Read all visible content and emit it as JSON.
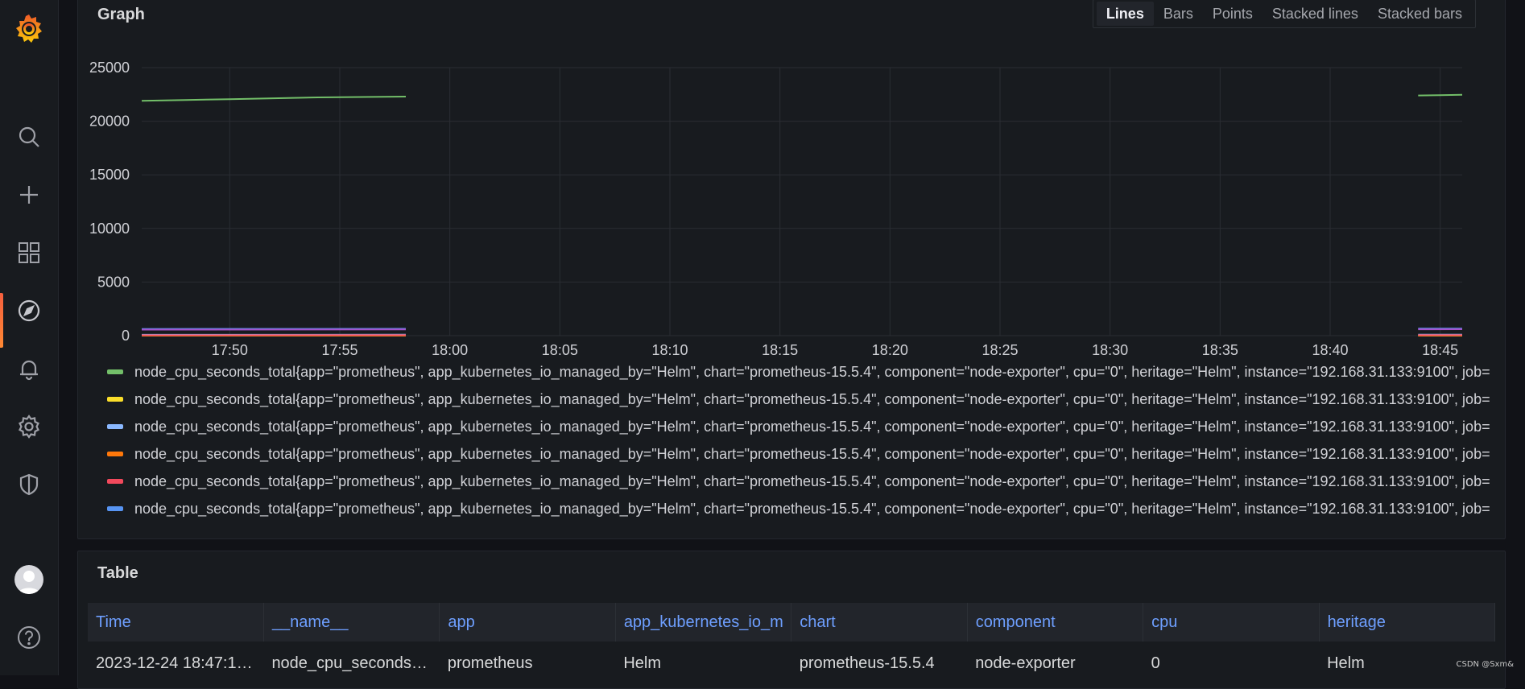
{
  "sidebar": {
    "logo": "grafana-logo",
    "items": [
      {
        "name": "search-icon"
      },
      {
        "name": "plus-icon"
      },
      {
        "name": "dashboards-icon"
      },
      {
        "name": "explore-icon",
        "active": true
      },
      {
        "name": "bell-icon"
      },
      {
        "name": "gear-icon"
      },
      {
        "name": "shield-icon"
      }
    ],
    "bottom": [
      {
        "name": "avatar"
      },
      {
        "name": "help-icon"
      }
    ]
  },
  "graph_panel": {
    "title": "Graph",
    "modes": [
      "Lines",
      "Bars",
      "Points",
      "Stacked lines",
      "Stacked bars"
    ],
    "active_mode": "Lines",
    "legend": [
      {
        "label": "node_cpu_seconds_total{app=\"prometheus\", app_kubernetes_io_managed_by=\"Helm\", chart=\"prometheus-15.5.4\", component=\"node-exporter\", cpu=\"0\", heritage=\"Helm\", instance=\"192.168.31.133:9100\", job=",
        "color": "#73bf69"
      },
      {
        "label": "node_cpu_seconds_total{app=\"prometheus\", app_kubernetes_io_managed_by=\"Helm\", chart=\"prometheus-15.5.4\", component=\"node-exporter\", cpu=\"0\", heritage=\"Helm\", instance=\"192.168.31.133:9100\", job=",
        "color": "#fade2a"
      },
      {
        "label": "node_cpu_seconds_total{app=\"prometheus\", app_kubernetes_io_managed_by=\"Helm\", chart=\"prometheus-15.5.4\", component=\"node-exporter\", cpu=\"0\", heritage=\"Helm\", instance=\"192.168.31.133:9100\", job=",
        "color": "#8ab8ff"
      },
      {
        "label": "node_cpu_seconds_total{app=\"prometheus\", app_kubernetes_io_managed_by=\"Helm\", chart=\"prometheus-15.5.4\", component=\"node-exporter\", cpu=\"0\", heritage=\"Helm\", instance=\"192.168.31.133:9100\", job=",
        "color": "#ff780a"
      },
      {
        "label": "node_cpu_seconds_total{app=\"prometheus\", app_kubernetes_io_managed_by=\"Helm\", chart=\"prometheus-15.5.4\", component=\"node-exporter\", cpu=\"0\", heritage=\"Helm\", instance=\"192.168.31.133:9100\", job=",
        "color": "#f2495c"
      },
      {
        "label": "node_cpu_seconds_total{app=\"prometheus\", app_kubernetes_io_managed_by=\"Helm\", chart=\"prometheus-15.5.4\", component=\"node-exporter\", cpu=\"0\", heritage=\"Helm\", instance=\"192.168.31.133:9100\", job=",
        "color": "#5794f2"
      }
    ]
  },
  "chart_data": {
    "type": "line",
    "title": "Graph",
    "xlabel": "",
    "ylabel": "",
    "x_ticks": [
      "17:50",
      "17:55",
      "18:00",
      "18:05",
      "18:10",
      "18:15",
      "18:20",
      "18:25",
      "18:30",
      "18:35",
      "18:40",
      "18:45"
    ],
    "xlim": [
      "17:46",
      "18:46"
    ],
    "y_ticks": [
      0,
      5000,
      10000,
      15000,
      20000,
      25000
    ],
    "ylim": [
      0,
      25000
    ],
    "grid": true,
    "legend_position": "bottom",
    "series": [
      {
        "color": "#73bf69",
        "segments": [
          {
            "x": [
              "17:46",
              "17:48",
              "17:50",
              "17:52",
              "17:54",
              "17:56",
              "17:58"
            ],
            "y": [
              21900,
              21980,
              22060,
              22140,
              22220,
              22260,
              22300
            ]
          },
          {
            "x": [
              "18:44",
              "18:45",
              "18:46"
            ],
            "y": [
              22400,
              22430,
              22460
            ]
          }
        ]
      },
      {
        "color": "#fade2a",
        "segments": [
          {
            "x": [
              "17:46",
              "17:58"
            ],
            "y": [
              0,
              0
            ]
          },
          {
            "x": [
              "18:44",
              "18:46"
            ],
            "y": [
              0,
              0
            ]
          }
        ]
      },
      {
        "color": "#8ab8ff",
        "segments": [
          {
            "x": [
              "17:46",
              "17:58"
            ],
            "y": [
              80,
              90
            ]
          },
          {
            "x": [
              "18:44",
              "18:46"
            ],
            "y": [
              90,
              95
            ]
          }
        ]
      },
      {
        "color": "#ff780a",
        "segments": [
          {
            "x": [
              "17:46",
              "17:58"
            ],
            "y": [
              20,
              25
            ]
          },
          {
            "x": [
              "18:44",
              "18:46"
            ],
            "y": [
              25,
              28
            ]
          }
        ]
      },
      {
        "color": "#f2495c",
        "segments": [
          {
            "x": [
              "17:46",
              "17:58"
            ],
            "y": [
              40,
              45
            ]
          },
          {
            "x": [
              "18:44",
              "18:46"
            ],
            "y": [
              45,
              48
            ]
          }
        ]
      },
      {
        "color": "#5794f2",
        "segments": [
          {
            "x": [
              "17:46",
              "17:58"
            ],
            "y": [
              620,
              640
            ]
          },
          {
            "x": [
              "18:44",
              "18:46"
            ],
            "y": [
              650,
              660
            ]
          }
        ]
      },
      {
        "color": "#a352cc",
        "segments": [
          {
            "x": [
              "17:46",
              "17:58"
            ],
            "y": [
              560,
              580
            ]
          },
          {
            "x": [
              "18:44",
              "18:46"
            ],
            "y": [
              590,
              600
            ]
          }
        ]
      }
    ]
  },
  "table_panel": {
    "title": "Table",
    "columns": [
      "Time",
      "__name__",
      "app",
      "app_kubernetes_io_m",
      "chart",
      "component",
      "cpu",
      "heritage"
    ],
    "rows": [
      [
        "2023-12-24 18:47:1…",
        "node_cpu_seconds…",
        "prometheus",
        "Helm",
        "prometheus-15.5.4",
        "node-exporter",
        "0",
        "Helm"
      ]
    ]
  },
  "watermark": "CSDN @Sxm&"
}
